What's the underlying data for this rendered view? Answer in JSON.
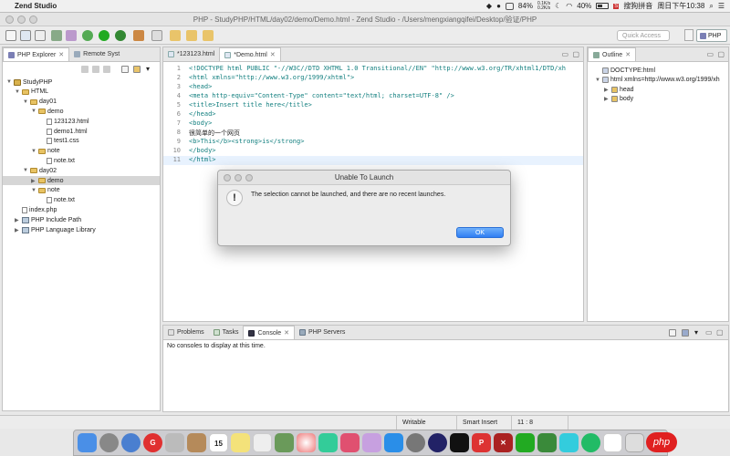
{
  "menubar": {
    "app_name": "Zend Studio",
    "battery_pct": "84%",
    "net_up": "0.1K/s",
    "net_down": "0.2K/s",
    "wifi_pct": "40%",
    "ime": "搜狗拼音",
    "clock": "周日下午10:38"
  },
  "window": {
    "title": "PHP - StudyPHP/HTML/day02/demo/Demo.html - Zend Studio - /Users/mengxiangqifei/Desktop/验证/PHP"
  },
  "toolbar": {
    "quick_access_placeholder": "Quick Access",
    "perspective_label": "PHP"
  },
  "explorer": {
    "tab_label": "PHP Explorer",
    "remote_tab_label": "Remote Syst",
    "tree": [
      {
        "label": "StudyPHP",
        "level": 0,
        "icon": "project-icon",
        "expanded": true
      },
      {
        "label": "HTML",
        "level": 1,
        "icon": "folder-icon",
        "expanded": true
      },
      {
        "label": "day01",
        "level": 2,
        "icon": "folder-icon",
        "expanded": true
      },
      {
        "label": "demo",
        "level": 3,
        "icon": "folder-icon",
        "expanded": true
      },
      {
        "label": "123123.html",
        "level": 4,
        "icon": "file-icon"
      },
      {
        "label": "demo1.html",
        "level": 4,
        "icon": "file-icon"
      },
      {
        "label": "test1.css",
        "level": 4,
        "icon": "file-icon"
      },
      {
        "label": "note",
        "level": 3,
        "icon": "folder-icon",
        "expanded": true
      },
      {
        "label": "note.txt",
        "level": 4,
        "icon": "file-icon"
      },
      {
        "label": "day02",
        "level": 2,
        "icon": "folder-icon",
        "expanded": true
      },
      {
        "label": "demo",
        "level": 3,
        "icon": "folder-icon",
        "expanded": false,
        "selected": true
      },
      {
        "label": "note",
        "level": 3,
        "icon": "folder-icon",
        "expanded": true
      },
      {
        "label": "note.txt",
        "level": 4,
        "icon": "file-icon"
      },
      {
        "label": "index.php",
        "level": 1,
        "icon": "file-icon"
      },
      {
        "label": "PHP Include Path",
        "level": 1,
        "icon": "library-icon",
        "expanded": false
      },
      {
        "label": "PHP Language Library",
        "level": 1,
        "icon": "library-icon",
        "expanded": false
      }
    ]
  },
  "editor": {
    "tabs": [
      {
        "label": "*123123.html",
        "active": false
      },
      {
        "label": "*Demo.html",
        "active": true
      }
    ],
    "lines": [
      {
        "n": "1",
        "text": "<!DOCTYPE html PUBLIC \"-//W3C//DTD XHTML 1.0 Transitional//EN\" \"http://www.w3.org/TR/xhtml1/DTD/xh"
      },
      {
        "n": "2",
        "text": "<html xmlns=\"http://www.w3.org/1999/xhtml\">"
      },
      {
        "n": "3",
        "text": "<head>"
      },
      {
        "n": "4",
        "text": "<meta http-equiv=\"Content-Type\" content=\"text/html; charset=UTF-8\" />"
      },
      {
        "n": "5",
        "text": "<title>Insert title here</title>"
      },
      {
        "n": "6",
        "text": "</head>"
      },
      {
        "n": "7",
        "text": "<body>"
      },
      {
        "n": "8",
        "text": "很简单的一个网页"
      },
      {
        "n": "9",
        "text": "<b>This</b><strong>is</strong>"
      },
      {
        "n": "10",
        "text": "</body>"
      },
      {
        "n": "11",
        "text": "</html>"
      }
    ]
  },
  "outline": {
    "tab_label": "Outline",
    "tree": [
      {
        "label": "DOCTYPE:html",
        "level": 0
      },
      {
        "label": "html xmlns=http://www.w3.org/1999/xh",
        "level": 0,
        "expanded": true
      },
      {
        "label": "head",
        "level": 1
      },
      {
        "label": "body",
        "level": 1
      }
    ]
  },
  "bottom_panel": {
    "tabs": [
      {
        "label": "Problems",
        "active": false
      },
      {
        "label": "Tasks",
        "active": false
      },
      {
        "label": "Console",
        "active": true
      },
      {
        "label": "PHP Servers",
        "active": false
      }
    ],
    "console_text": "No consoles to display at this time."
  },
  "dialog": {
    "title": "Unable To Launch",
    "message": "The selection cannot be launched, and there are no recent launches.",
    "ok_label": "OK"
  },
  "statusbar": {
    "mode": "Writable",
    "insert_mode": "Smart Insert",
    "position": "11 : 8"
  },
  "dock": {
    "calendar_day": "15",
    "watermark": "php"
  }
}
